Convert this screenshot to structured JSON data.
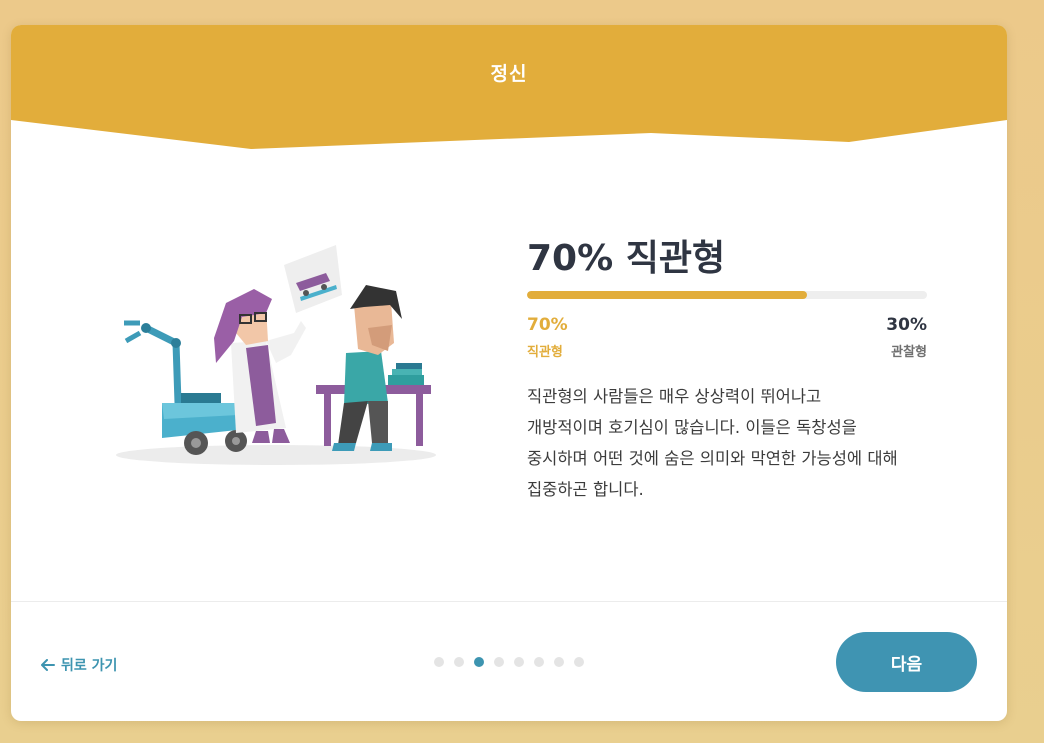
{
  "header": {
    "title": "정신"
  },
  "result": {
    "title": "70% 직관형",
    "fill_fraction": 0.7,
    "left_percent": "70%",
    "left_label": "직관형",
    "right_percent": "30%",
    "right_label": "관찰형",
    "description_lines": [
      "직관형의 사람들은 매우 상상력이 뛰어나고",
      "개방적이며 호기심이 많습니다. 이들은 독창성을",
      "중시하며 어떤 것에 숨은 의미와 막연한 가능성에 대해",
      "집중하곤 합니다."
    ]
  },
  "footer": {
    "back_label": "뒤로 가기",
    "next_label": "다음",
    "dots_total": 8,
    "dots_active_index": 2
  },
  "colors": {
    "accent": "#e2ad3b",
    "primary": "#3f94b2",
    "text_dark": "#2f3542"
  }
}
